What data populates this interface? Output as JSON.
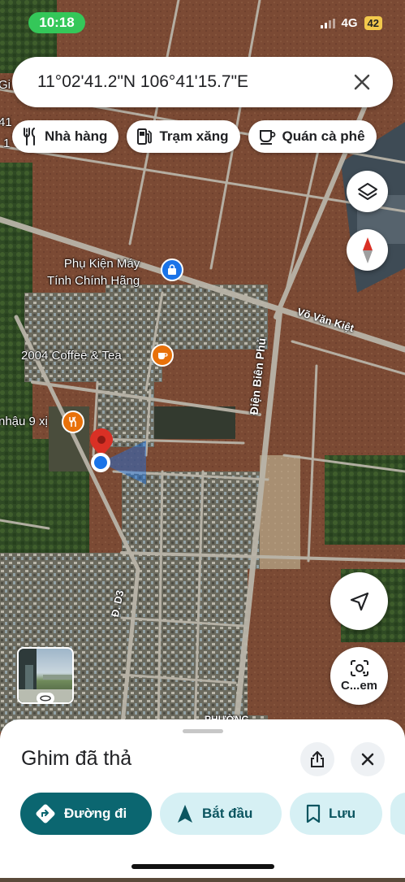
{
  "status": {
    "time": "10:18",
    "network": "4G",
    "battery": "42"
  },
  "search": {
    "value": "11°02'41.2\"N 106°41'15.7\"E"
  },
  "chips": [
    {
      "label": "Nhà hàng",
      "icon": "fork-knife-icon"
    },
    {
      "label": "Trạm xăng",
      "icon": "gas-pump-icon"
    },
    {
      "label": "Quán cà phê",
      "icon": "coffee-cup-icon"
    }
  ],
  "map": {
    "labels": {
      "poi_1": "Phụ Kiện Máy\nTính Chính Hãng",
      "poi_2": "2004 Coffee & Tea",
      "poi_3": "nhậu 9 xị",
      "road_1": "Võ Văn Kiệt",
      "road_2": "Điện Biên Phủ",
      "road_3": "Đ. D3",
      "area_1": "PHƯỜNG",
      "edge_1": "Gi",
      "edge_2": "41",
      "edge_3": "1"
    }
  },
  "controls": {
    "recenter_label": "C...em"
  },
  "sheet": {
    "title": "Ghim đã thả",
    "actions": [
      {
        "label": "Đường đi"
      },
      {
        "label": "Bắt đầu"
      },
      {
        "label": "Lưu"
      }
    ]
  },
  "colors": {
    "accent": "#0b6670",
    "accent_light": "#d6f0f4",
    "status_green": "#34c759",
    "poi_blue": "#1a73e8",
    "poi_orange": "#e8710a",
    "pin_red": "#d93025"
  }
}
